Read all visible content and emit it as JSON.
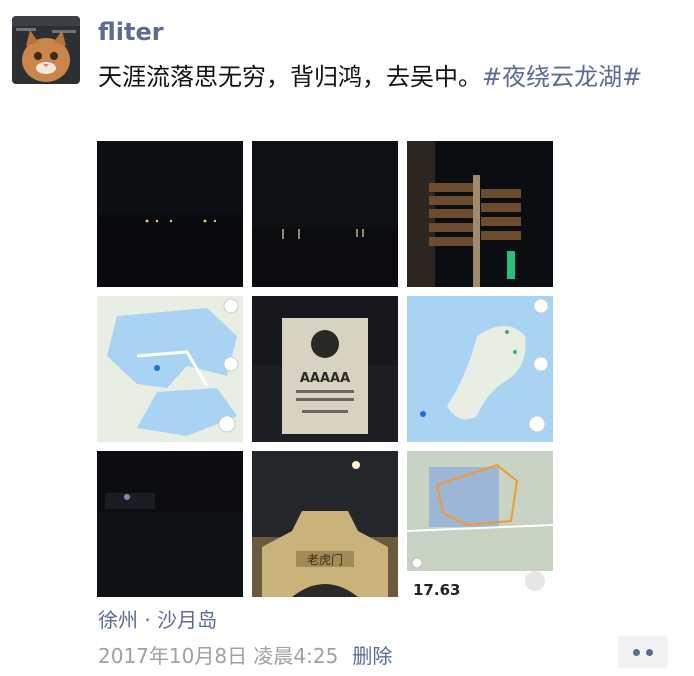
{
  "post": {
    "username": "fliter",
    "text": "天涯流落思无穷，背归鸿，去吴中。",
    "hashtag": "#夜绕云龙湖#",
    "location": "徐州 · 沙月岛",
    "timestamp": "2017年10月8日 凌晨4:25",
    "delete_label": "删除",
    "more_icon": "more-dots-icon"
  },
  "photos": [
    {
      "kind": "night-lake-lights"
    },
    {
      "kind": "night-lake-reflection"
    },
    {
      "kind": "night-signpost"
    },
    {
      "kind": "map-lake-district"
    },
    {
      "kind": "aaaaa-scenic-sign",
      "sign_text": "AAAAA"
    },
    {
      "kind": "map-lake-island"
    },
    {
      "kind": "night-shore"
    },
    {
      "kind": "night-gate-with-moon",
      "gate_text": "老虎门"
    },
    {
      "kind": "running-track-map",
      "distance": "17.63"
    }
  ],
  "colors": {
    "name": "#5b6b93",
    "text": "#111111",
    "meta": "#a0a0a0",
    "map_water": "#a9d3f2",
    "map_land": "#e8eee4"
  }
}
